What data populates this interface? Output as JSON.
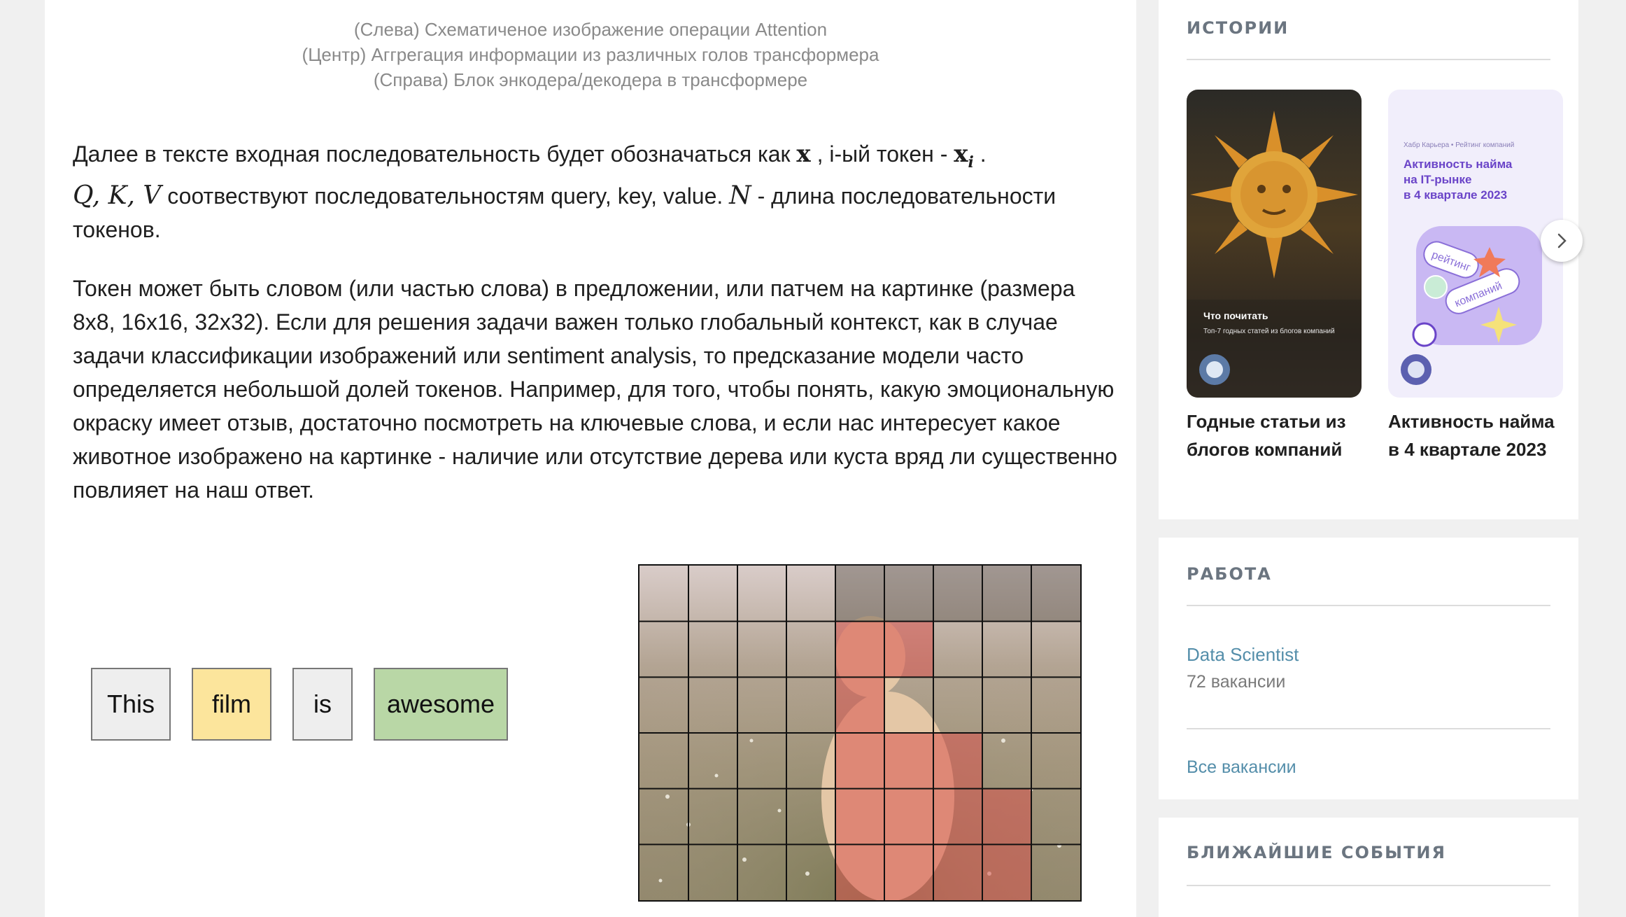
{
  "captions": [
    "(Слева) Схематиченое изображение операции Attention",
    "(Центр) Аггрегация информации из различных голов трансформера",
    "(Справа) Блок энкодера/декодера в трансформере"
  ],
  "paragraph1": {
    "t1": "Далее в тексте входная последовательность будет обозначаться как ",
    "m_x": "x",
    "t2": " , i-ый токен - ",
    "m_xi": "x",
    "m_xi_sub": "i",
    "t3": " .",
    "m_qkv": "Q, K, V",
    "t4": " соотвествуют последовательностям query, key, value. ",
    "m_n": "N",
    "t5": " - длина последовательности токенов."
  },
  "paragraph2": "Токен может быть словом (или частью слова) в предложении, или патчем на картинке (размера 8x8, 16x16, 32x32). Если для решения задачи важен только глобальный контекст, как в случае задачи классификации изображений или sentiment analysis, то предсказание модели часто определяется небольшой долей токенов. Например, для того, чтобы понять, какую эмоциональную окраску имеет отзыв, достаточно посмотреть на ключевые слова, и если нас интересует какое животное изображено на картинке - наличие или отсутствие дерева или куста вряд ли существенно повлияет на наш ответ.",
  "tokens": [
    {
      "text": "This",
      "color": "#eeeeee"
    },
    {
      "text": "film",
      "color": "#fce59c"
    },
    {
      "text": "is",
      "color": "#eeeeee"
    },
    {
      "text": "awesome",
      "color": "#b9d7a6"
    }
  ],
  "patch_grid": {
    "cols": 9,
    "rows": 6,
    "highlight_color": "#d9534f"
  },
  "sidebar": {
    "stories_title": "ИСТОРИИ",
    "stories": [
      {
        "caption": "Годные статьи из блогов компаний",
        "overlay_title": "Что почитать",
        "overlay_sub": "Топ-7 годных статей из блогов компаний"
      },
      {
        "caption": "Активность найма в 4 квартале 2023",
        "header": "Хабр Карьера • Рейтинг компаний",
        "headline": "Активность найма на IT-рынке в 4 квартале 2023",
        "pill1": "рейтинг",
        "pill2": "компаний"
      }
    ],
    "jobs_title": "РАБОТА",
    "job_link": "Data Scientist",
    "job_count": "72 вакансии",
    "all_jobs": "Все вакансии",
    "events_title": "БЛИЖАЙШИЕ СОБЫТИЯ"
  }
}
